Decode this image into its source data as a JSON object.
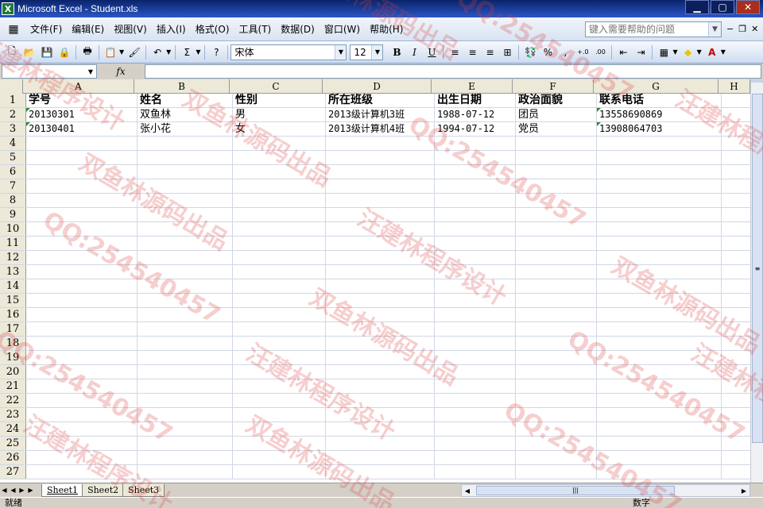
{
  "window": {
    "title": "Microsoft Excel - Student.xls",
    "app_icon_glyph": "X"
  },
  "menu": {
    "items": [
      "文件(F)",
      "编辑(E)",
      "视图(V)",
      "插入(I)",
      "格式(O)",
      "工具(T)",
      "数据(D)",
      "窗口(W)",
      "帮助(H)"
    ],
    "help_placeholder": "键入需要帮助的问题"
  },
  "toolbar": {
    "font_name": "宋体",
    "font_size": "12",
    "bold": "B",
    "italic": "I",
    "underline": "U",
    "sum": "Σ",
    "percent": "%",
    "comma": ",",
    "inc_decimal": "+.0\n.00",
    "dec_decimal": ".00\n+.0"
  },
  "formula_bar": {
    "name_box": "",
    "fx_label": "fx",
    "formula": ""
  },
  "sheet": {
    "columns": [
      "A",
      "B",
      "C",
      "D",
      "E",
      "F",
      "G",
      "H"
    ],
    "row_numbers": [
      "1",
      "2",
      "3",
      "4",
      "5",
      "6",
      "7",
      "8",
      "9",
      "10",
      "11",
      "12",
      "13",
      "14",
      "15",
      "16",
      "17",
      "18",
      "19",
      "20",
      "21",
      "22",
      "23",
      "24",
      "25",
      "26",
      "27"
    ],
    "rows": [
      [
        "学号",
        "姓名",
        "性别",
        "所在班级",
        "出生日期",
        "政治面貌",
        "联系电话"
      ],
      [
        "20130301",
        "双鱼林",
        "男",
        "2013级计算机3班",
        "1988-07-12",
        "团员",
        "13558690869"
      ],
      [
        "20130401",
        "张小花",
        "女",
        "2013级计算机4班",
        "1994-07-12",
        "党员",
        "13908064703"
      ]
    ]
  },
  "tabs": {
    "sheets": [
      "Sheet1",
      "Sheet2",
      "Sheet3"
    ],
    "active": "Sheet1"
  },
  "status": {
    "ready": "就绪",
    "numlock": "数字"
  },
  "watermarks": [
    "双鱼林源码出品",
    "QQ:254540457",
    "汪建林程序设计"
  ],
  "colors": {
    "title_bar": "#0a246a",
    "menu_bg": "#d9e3f1",
    "grid_line": "#d0d7e5",
    "header_bg": "#ece9d8",
    "watermark": "#dc3c3c"
  }
}
